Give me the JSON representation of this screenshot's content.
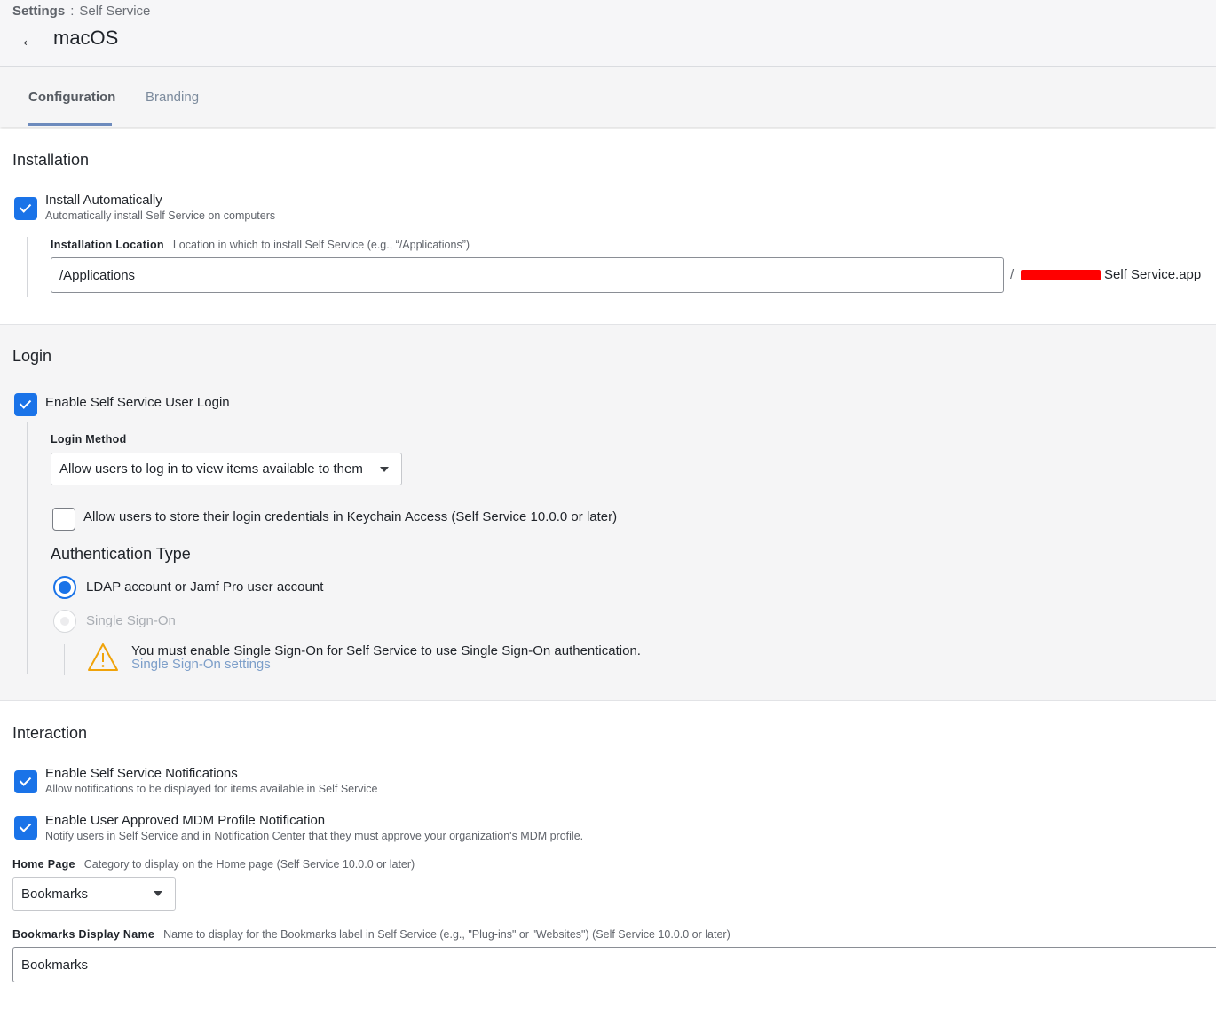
{
  "breadcrumb": {
    "root": "Settings",
    "separator": ":",
    "current": "Self Service"
  },
  "page": {
    "title": "macOS",
    "back_icon": "arrow-left-icon"
  },
  "tabs": [
    {
      "label": "Configuration",
      "active": true
    },
    {
      "label": "Branding",
      "active": false
    }
  ],
  "installation": {
    "title": "Installation",
    "install_auto": {
      "label": "Install Automatically",
      "desc": "Automatically install Self Service on computers",
      "checked": true
    },
    "location": {
      "label": "Installation Location",
      "help": "Location in which to install Self Service (e.g., “/Applications”)",
      "value": "/Applications",
      "suffix_prefix": "/",
      "suffix": "Self Service.app"
    }
  },
  "login": {
    "title": "Login",
    "enable_login": {
      "label": "Enable Self Service User Login",
      "checked": true
    },
    "method": {
      "label": "Login Method",
      "value": "Allow users to log in to view items available to them"
    },
    "keychain": {
      "label": "Allow users to store their login credentials in Keychain Access (Self Service 10.0.0 or later)",
      "checked": false
    },
    "auth": {
      "title": "Authentication Type",
      "options": [
        {
          "label": "LDAP account or Jamf Pro user account",
          "selected": true,
          "disabled": false
        },
        {
          "label": "Single Sign-On",
          "selected": false,
          "disabled": true
        }
      ],
      "warning": {
        "text": "You must enable Single Sign-On for Self Service to use Single Sign-On authentication.",
        "link": "Single Sign-On settings"
      }
    }
  },
  "interaction": {
    "title": "Interaction",
    "notifications": {
      "label": "Enable Self Service Notifications",
      "desc": "Allow notifications to be displayed for items available in Self Service",
      "checked": true
    },
    "mdm": {
      "label": "Enable User Approved MDM Profile Notification",
      "desc": "Notify users in Self Service and in Notification Center that they must approve your organization's MDM profile.",
      "checked": true
    },
    "home_page": {
      "label": "Home Page",
      "help": "Category to display on the Home page (Self Service 10.0.0 or later)",
      "value": "Bookmarks"
    },
    "bookmarks_name": {
      "label": "Bookmarks Display Name",
      "help": "Name to display for the Bookmarks label in Self Service (e.g., \"Plug-ins\" or \"Websites\") (Self Service 10.0.0 or later)",
      "value": "Bookmarks"
    }
  },
  "colors": {
    "accent": "#1a73e8",
    "warning": "#f0a30a",
    "link": "#7c9ec9"
  }
}
